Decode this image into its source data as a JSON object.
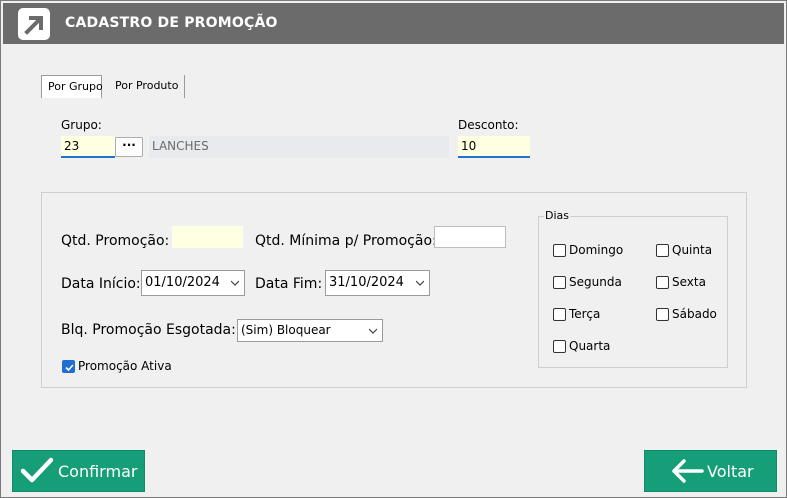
{
  "window": {
    "title": "CADASTRO DE PROMOÇÃO",
    "accent": "#169e78",
    "titlebar_color": "#6b6b6b"
  },
  "tabs": [
    {
      "label": "Por Grupo",
      "active": true
    },
    {
      "label": "Por Produto",
      "active": false
    }
  ],
  "grupo": {
    "label": "Grupo:",
    "code": "23",
    "lookup_label": "···",
    "name": "LANCHES"
  },
  "desconto": {
    "label": "Desconto:",
    "value": "10"
  },
  "form": {
    "qtd_promocao_label": "Qtd. Promoção:",
    "qtd_promocao_value": "",
    "qtd_minima_label": "Qtd. Mínima p/ Promoção:",
    "qtd_minima_value": "",
    "data_inicio_label": "Data Início:",
    "data_inicio_value": "01/10/2024",
    "data_fim_label": "Data Fim:",
    "data_fim_value": "31/10/2024",
    "blq_label": "Blq. Promoção Esgotada:",
    "blq_value": "(Sim) Bloquear",
    "ativa_label": "Promoção Ativa",
    "ativa_checked": true
  },
  "dias": {
    "legend": "Dias",
    "items": [
      {
        "label": "Domingo",
        "checked": false
      },
      {
        "label": "Segunda",
        "checked": false
      },
      {
        "label": "Terça",
        "checked": false
      },
      {
        "label": "Quarta",
        "checked": false
      },
      {
        "label": "Quinta",
        "checked": false
      },
      {
        "label": "Sexta",
        "checked": false
      },
      {
        "label": "Sábado",
        "checked": false
      }
    ]
  },
  "actions": {
    "confirm_label": "Confirmar",
    "back_label": "Voltar"
  }
}
